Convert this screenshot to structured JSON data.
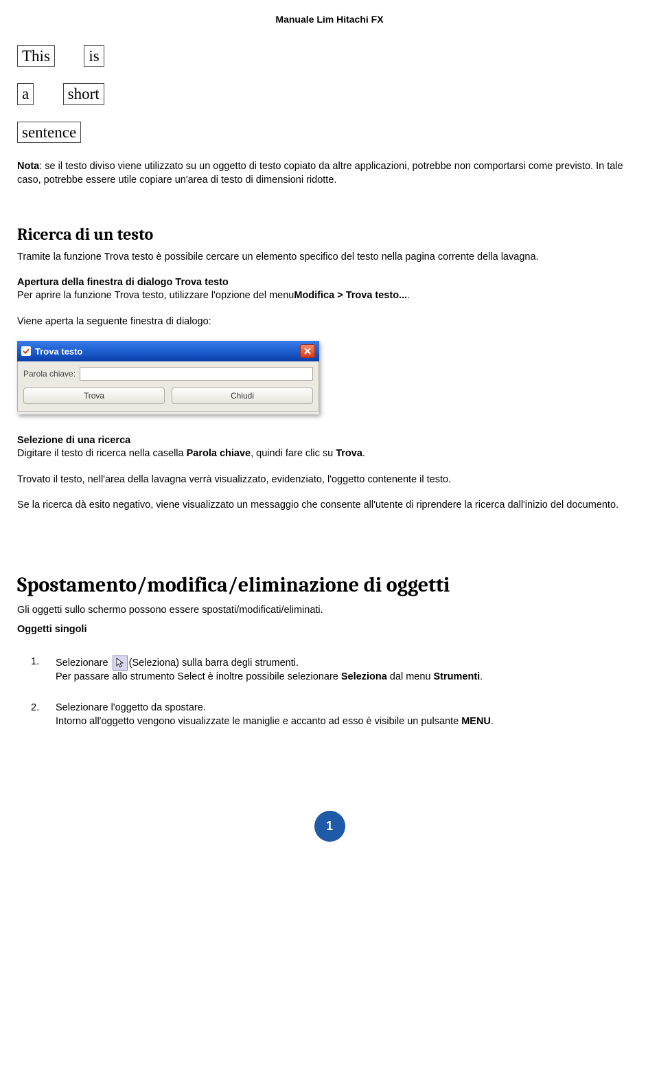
{
  "header": {
    "title": "Manuale Lim Hitachi FX"
  },
  "boxes": {
    "r1c1": "This",
    "r1c2": "is",
    "r2c1": "a",
    "r2c2": "short",
    "r3c1": "sentence"
  },
  "nota": {
    "label": "Nota",
    "text": ": se il testo diviso viene utilizzato su un oggetto di testo copiato da altre applicazioni, potrebbe non comportarsi come previsto. In tale caso, potrebbe essere utile copiare un'area di testo di dimensioni ridotte."
  },
  "sec1": {
    "heading": "Ricerca di un testo",
    "p1": "Tramite la funzione Trova testo è possibile cercare un elemento specifico del testo nella pagina corrente della lavagna.",
    "sub1": "Apertura della finestra di dialogo Trova testo",
    "p2a": "Per aprire la funzione Trova testo, utilizzare l'opzione del menu",
    "p2b": "Modifica > Trova testo...",
    "p2c": ".",
    "p3": "Viene aperta la seguente finestra di dialogo:"
  },
  "dialog": {
    "title": "Trova testo",
    "field_label": "Parola chiave:",
    "btn_find": "Trova",
    "btn_close": "Chiudi"
  },
  "sec2": {
    "sub": "Selezione di una ricerca",
    "p1a": "Digitare il testo di ricerca nella casella ",
    "p1b": "Parola chiave",
    "p1c": ", quindi fare clic su ",
    "p1d": "Trova",
    "p1e": ".",
    "p2": "Trovato il testo, nell'area della lavagna verrà visualizzato, evidenziato, l'oggetto contenente il testo.",
    "p3": "Se la ricerca dà esito negativo, viene visualizzato un messaggio che consente all'utente di riprendere la ricerca dall'inizio del documento."
  },
  "sec3": {
    "heading": "Spostamento/modifica/eliminazione di oggetti",
    "p1": "Gli oggetti sullo schermo possono essere spostati/modificati/eliminati.",
    "sub": "Oggetti singoli",
    "li1_num": "1.",
    "li1_a": "Selezionare ",
    "li1_b": "(Seleziona) sulla barra degli strumenti.",
    "li1_c1": "Per passare allo strumento Select è inoltre possibile selezionare ",
    "li1_c2": "Seleziona",
    "li1_c3": " dal menu ",
    "li1_c4": "Strumenti",
    "li1_c5": ".",
    "li2_num": "2.",
    "li2_a": "Selezionare l'oggetto da spostare.",
    "li2_b1": "Intorno all'oggetto vengono visualizzate le maniglie e accanto ad esso è visibile un pulsante ",
    "li2_b2": "MENU",
    "li2_b3": "."
  },
  "page_number": "1"
}
